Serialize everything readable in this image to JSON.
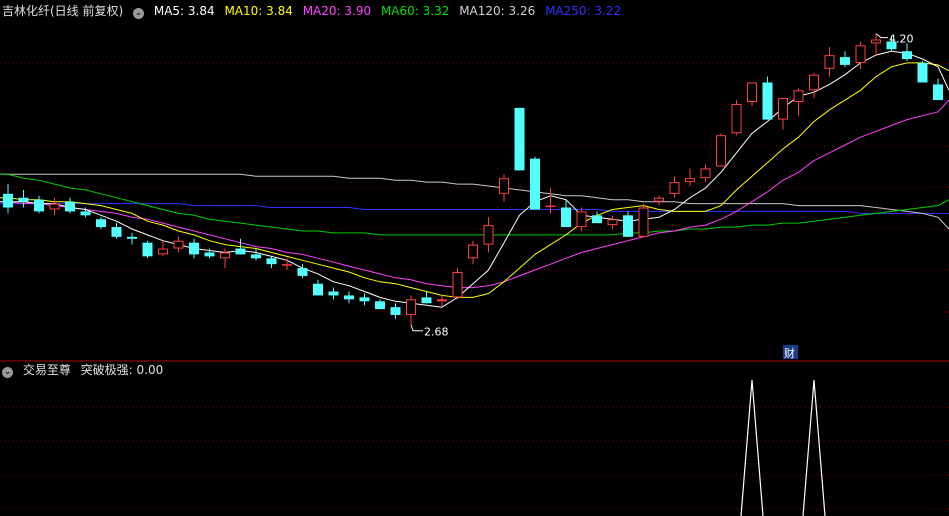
{
  "header": {
    "stock_title": "吉林化纤(日线 前复权)",
    "ma": [
      {
        "label": "MA5: 3.84",
        "color": "#ffffff"
      },
      {
        "label": "MA10: 3.84",
        "color": "#ffff00"
      },
      {
        "label": "MA20: 3.90",
        "color": "#ff40ff"
      },
      {
        "label": "MA60: 3.32",
        "color": "#00e000"
      },
      {
        "label": "MA120: 3.26",
        "color": "#d0d0d0"
      },
      {
        "label": "MA250: 3.22",
        "color": "#3030ff"
      }
    ]
  },
  "indicator": {
    "name": "交易至尊",
    "value_label": "突破极强: 0.00"
  },
  "annotations": {
    "high": "4.20",
    "low": "2.68",
    "marker": "财"
  },
  "colors": {
    "up": "#ff4040",
    "down": "#54ffff",
    "grid": "#7a0000",
    "ma5": "#ffffff",
    "ma10": "#ffff00",
    "ma20": "#ff40ff",
    "ma60": "#00d000",
    "ma120": "#c8c8c8",
    "ma250": "#3232ff",
    "signal": "#ffffff"
  },
  "chart_data": {
    "type": "candlestick",
    "price_range": [
      2.55,
      4.28
    ],
    "candles": [
      [
        3.38,
        3.43,
        3.28,
        3.31
      ],
      [
        3.36,
        3.4,
        3.31,
        3.34
      ],
      [
        3.35,
        3.37,
        3.28,
        3.29
      ],
      [
        3.3,
        3.36,
        3.27,
        3.33
      ],
      [
        3.34,
        3.36,
        3.28,
        3.29
      ],
      [
        3.29,
        3.31,
        3.26,
        3.27
      ],
      [
        3.25,
        3.26,
        3.2,
        3.21
      ],
      [
        3.21,
        3.23,
        3.15,
        3.16
      ],
      [
        3.16,
        3.18,
        3.12,
        3.15
      ],
      [
        3.13,
        3.14,
        3.05,
        3.06
      ],
      [
        3.07,
        3.14,
        3.06,
        3.1
      ],
      [
        3.1,
        3.16,
        3.08,
        3.14
      ],
      [
        3.13,
        3.15,
        3.05,
        3.07
      ],
      [
        3.08,
        3.1,
        3.05,
        3.06
      ],
      [
        3.05,
        3.1,
        3.0,
        3.08
      ],
      [
        3.1,
        3.15,
        3.07,
        3.07
      ],
      [
        3.07,
        3.1,
        3.04,
        3.05
      ],
      [
        3.05,
        3.06,
        3.0,
        3.02
      ],
      [
        3.02,
        3.05,
        2.99,
        3.02
      ],
      [
        3.0,
        3.02,
        2.95,
        2.96
      ],
      [
        2.92,
        2.94,
        2.86,
        2.86
      ],
      [
        2.88,
        2.9,
        2.84,
        2.86
      ],
      [
        2.86,
        2.88,
        2.82,
        2.84
      ],
      [
        2.85,
        2.87,
        2.81,
        2.83
      ],
      [
        2.83,
        2.84,
        2.79,
        2.79
      ],
      [
        2.8,
        2.82,
        2.74,
        2.76
      ],
      [
        2.76,
        2.86,
        2.71,
        2.84
      ],
      [
        2.85,
        2.88,
        2.82,
        2.82
      ],
      [
        2.83,
        2.86,
        2.8,
        2.84
      ],
      [
        2.85,
        3.0,
        2.84,
        2.98
      ],
      [
        3.05,
        3.14,
        3.02,
        3.12
      ],
      [
        3.12,
        3.26,
        3.08,
        3.22
      ],
      [
        3.38,
        3.48,
        3.34,
        3.46
      ],
      [
        3.82,
        3.82,
        3.5,
        3.5
      ],
      [
        3.56,
        3.57,
        3.3,
        3.3
      ],
      [
        3.32,
        3.41,
        3.28,
        3.32
      ],
      [
        3.31,
        3.35,
        3.21,
        3.21
      ],
      [
        3.21,
        3.31,
        3.19,
        3.29
      ],
      [
        3.27,
        3.29,
        3.23,
        3.23
      ],
      [
        3.22,
        3.27,
        3.2,
        3.25
      ],
      [
        3.27,
        3.29,
        3.16,
        3.16
      ],
      [
        3.16,
        3.33,
        3.16,
        3.31
      ],
      [
        3.34,
        3.37,
        3.32,
        3.36
      ],
      [
        3.38,
        3.47,
        3.36,
        3.44
      ],
      [
        3.44,
        3.51,
        3.42,
        3.46
      ],
      [
        3.46,
        3.53,
        3.44,
        3.51
      ],
      [
        3.52,
        3.69,
        3.52,
        3.68
      ],
      [
        3.69,
        3.86,
        3.68,
        3.84
      ],
      [
        3.85,
        3.95,
        3.83,
        3.95
      ],
      [
        3.95,
        3.98,
        3.76,
        3.76
      ],
      [
        3.76,
        3.87,
        3.71,
        3.87
      ],
      [
        3.85,
        3.92,
        3.78,
        3.91
      ],
      [
        3.91,
        4.0,
        3.87,
        3.99
      ],
      [
        4.02,
        4.13,
        3.98,
        4.09
      ],
      [
        4.08,
        4.11,
        4.03,
        4.04
      ],
      [
        4.05,
        4.16,
        4.02,
        4.14
      ],
      [
        4.15,
        4.2,
        4.09,
        4.17
      ],
      [
        4.16,
        4.19,
        4.11,
        4.12
      ],
      [
        4.11,
        4.15,
        4.06,
        4.07
      ],
      [
        4.05,
        4.06,
        3.95,
        3.95
      ],
      [
        3.94,
        3.97,
        3.86,
        3.86
      ]
    ],
    "ma5": [
      3.34,
      3.34,
      3.33,
      3.33,
      3.31,
      3.3,
      3.27,
      3.24,
      3.2,
      3.17,
      3.14,
      3.12,
      3.1,
      3.09,
      3.08,
      3.09,
      3.08,
      3.06,
      3.04,
      3.0,
      2.97,
      2.93,
      2.91,
      2.88,
      2.85,
      2.83,
      2.82,
      2.81,
      2.8,
      2.85,
      2.92,
      2.99,
      3.13,
      3.27,
      3.34,
      3.37,
      3.35,
      3.27,
      3.26,
      3.25,
      3.24,
      3.25,
      3.26,
      3.3,
      3.36,
      3.41,
      3.49,
      3.59,
      3.69,
      3.75,
      3.82,
      3.88,
      3.9,
      3.94,
      3.99,
      4.05,
      4.09,
      4.11,
      4.1,
      4.07,
      4.03
    ],
    "ma10": [
      3.36,
      3.35,
      3.35,
      3.34,
      3.34,
      3.33,
      3.32,
      3.3,
      3.28,
      3.24,
      3.22,
      3.19,
      3.17,
      3.14,
      3.12,
      3.11,
      3.1,
      3.08,
      3.06,
      3.04,
      3.02,
      3.0,
      2.98,
      2.95,
      2.93,
      2.92,
      2.9,
      2.88,
      2.86,
      2.85,
      2.85,
      2.87,
      2.93,
      3.0,
      3.07,
      3.12,
      3.17,
      3.23,
      3.27,
      3.3,
      3.31,
      3.32,
      3.3,
      3.29,
      3.29,
      3.29,
      3.32,
      3.4,
      3.47,
      3.54,
      3.61,
      3.67,
      3.75,
      3.81,
      3.86,
      3.91,
      3.98,
      4.03,
      4.05,
      4.05,
      4.04
    ],
    "ma20": [
      3.34,
      3.33,
      3.33,
      3.32,
      3.31,
      3.3,
      3.29,
      3.28,
      3.26,
      3.25,
      3.23,
      3.21,
      3.19,
      3.17,
      3.15,
      3.13,
      3.11,
      3.1,
      3.08,
      3.07,
      3.05,
      3.03,
      3.01,
      2.99,
      2.97,
      2.95,
      2.94,
      2.92,
      2.91,
      2.9,
      2.9,
      2.91,
      2.93,
      2.96,
      2.99,
      3.02,
      3.05,
      3.08,
      3.1,
      3.12,
      3.14,
      3.16,
      3.18,
      3.19,
      3.21,
      3.22,
      3.25,
      3.29,
      3.34,
      3.39,
      3.45,
      3.49,
      3.55,
      3.59,
      3.63,
      3.67,
      3.7,
      3.73,
      3.76,
      3.78,
      3.8
    ],
    "ma60": [
      3.48,
      3.46,
      3.45,
      3.43,
      3.41,
      3.4,
      3.38,
      3.36,
      3.34,
      3.32,
      3.3,
      3.28,
      3.27,
      3.25,
      3.24,
      3.23,
      3.22,
      3.21,
      3.2,
      3.19,
      3.19,
      3.18,
      3.18,
      3.18,
      3.17,
      3.17,
      3.17,
      3.17,
      3.17,
      3.17,
      3.17,
      3.17,
      3.17,
      3.17,
      3.17,
      3.17,
      3.17,
      3.17,
      3.17,
      3.17,
      3.18,
      3.18,
      3.19,
      3.19,
      3.2,
      3.2,
      3.21,
      3.21,
      3.22,
      3.22,
      3.23,
      3.23,
      3.24,
      3.25,
      3.26,
      3.27,
      3.28,
      3.29,
      3.3,
      3.31,
      3.32
    ],
    "ma120": [
      3.48,
      3.48,
      3.48,
      3.48,
      3.48,
      3.48,
      3.48,
      3.48,
      3.48,
      3.48,
      3.48,
      3.48,
      3.48,
      3.48,
      3.48,
      3.48,
      3.47,
      3.47,
      3.47,
      3.47,
      3.47,
      3.47,
      3.46,
      3.46,
      3.46,
      3.45,
      3.45,
      3.44,
      3.44,
      3.43,
      3.43,
      3.42,
      3.41,
      3.4,
      3.39,
      3.38,
      3.37,
      3.37,
      3.36,
      3.35,
      3.35,
      3.34,
      3.34,
      3.34,
      3.33,
      3.33,
      3.33,
      3.33,
      3.33,
      3.33,
      3.33,
      3.32,
      3.32,
      3.32,
      3.32,
      3.32,
      3.31,
      3.3,
      3.29,
      3.28,
      3.26
    ],
    "ma250": [
      3.33,
      3.33,
      3.33,
      3.33,
      3.33,
      3.33,
      3.33,
      3.33,
      3.33,
      3.33,
      3.33,
      3.33,
      3.32,
      3.32,
      3.32,
      3.32,
      3.32,
      3.31,
      3.31,
      3.31,
      3.31,
      3.31,
      3.31,
      3.3,
      3.3,
      3.3,
      3.3,
      3.3,
      3.3,
      3.3,
      3.3,
      3.3,
      3.3,
      3.3,
      3.3,
      3.3,
      3.3,
      3.3,
      3.3,
      3.29,
      3.29,
      3.29,
      3.29,
      3.29,
      3.29,
      3.29,
      3.29,
      3.29,
      3.29,
      3.29,
      3.29,
      3.29,
      3.29,
      3.29,
      3.29,
      3.28,
      3.28,
      3.28,
      3.28,
      3.28,
      3.28
    ],
    "signal": {
      "range": [
        0,
        1
      ],
      "peaks_at_index": [
        48,
        52
      ]
    }
  }
}
